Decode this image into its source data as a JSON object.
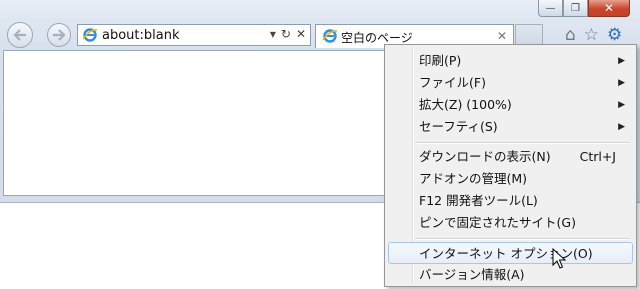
{
  "window": {
    "caption": {
      "minimize": "—",
      "maximize": "❐",
      "close": "✕"
    }
  },
  "nav": {
    "back_icon": "arrow-left-icon",
    "forward_icon": "arrow-right-icon"
  },
  "address_bar": {
    "url": "about:blank",
    "dropdown": "▾",
    "refresh": "↻",
    "stop": "✕"
  },
  "tab": {
    "title": "空白のページ",
    "close": "✕"
  },
  "toolbar_icons": {
    "home": "⌂",
    "favorites": "☆",
    "tools": "⚙"
  },
  "menu": {
    "items": [
      {
        "label": "印刷(P)",
        "submenu": true
      },
      {
        "label": "ファイル(F)",
        "submenu": true
      },
      {
        "label": "拡大(Z) (100%)",
        "submenu": true
      },
      {
        "label": "セーフティ(S)",
        "submenu": true
      },
      {
        "label": "ダウンロードの表示(N)",
        "shortcut": "Ctrl+J"
      },
      {
        "label": "アドオンの管理(M)"
      },
      {
        "label": "F12 開発者ツール(L)"
      },
      {
        "label": "ピンで固定されたサイト(G)"
      },
      {
        "label": "インターネット オプション(O)",
        "highlighted": true
      },
      {
        "label": "バージョン情報(A)"
      }
    ],
    "submenu_arrow": "▶"
  },
  "colors": {
    "accent": "#2b6fc2",
    "close_button": "#c7412a",
    "highlight_border": "#a8c6ea"
  }
}
